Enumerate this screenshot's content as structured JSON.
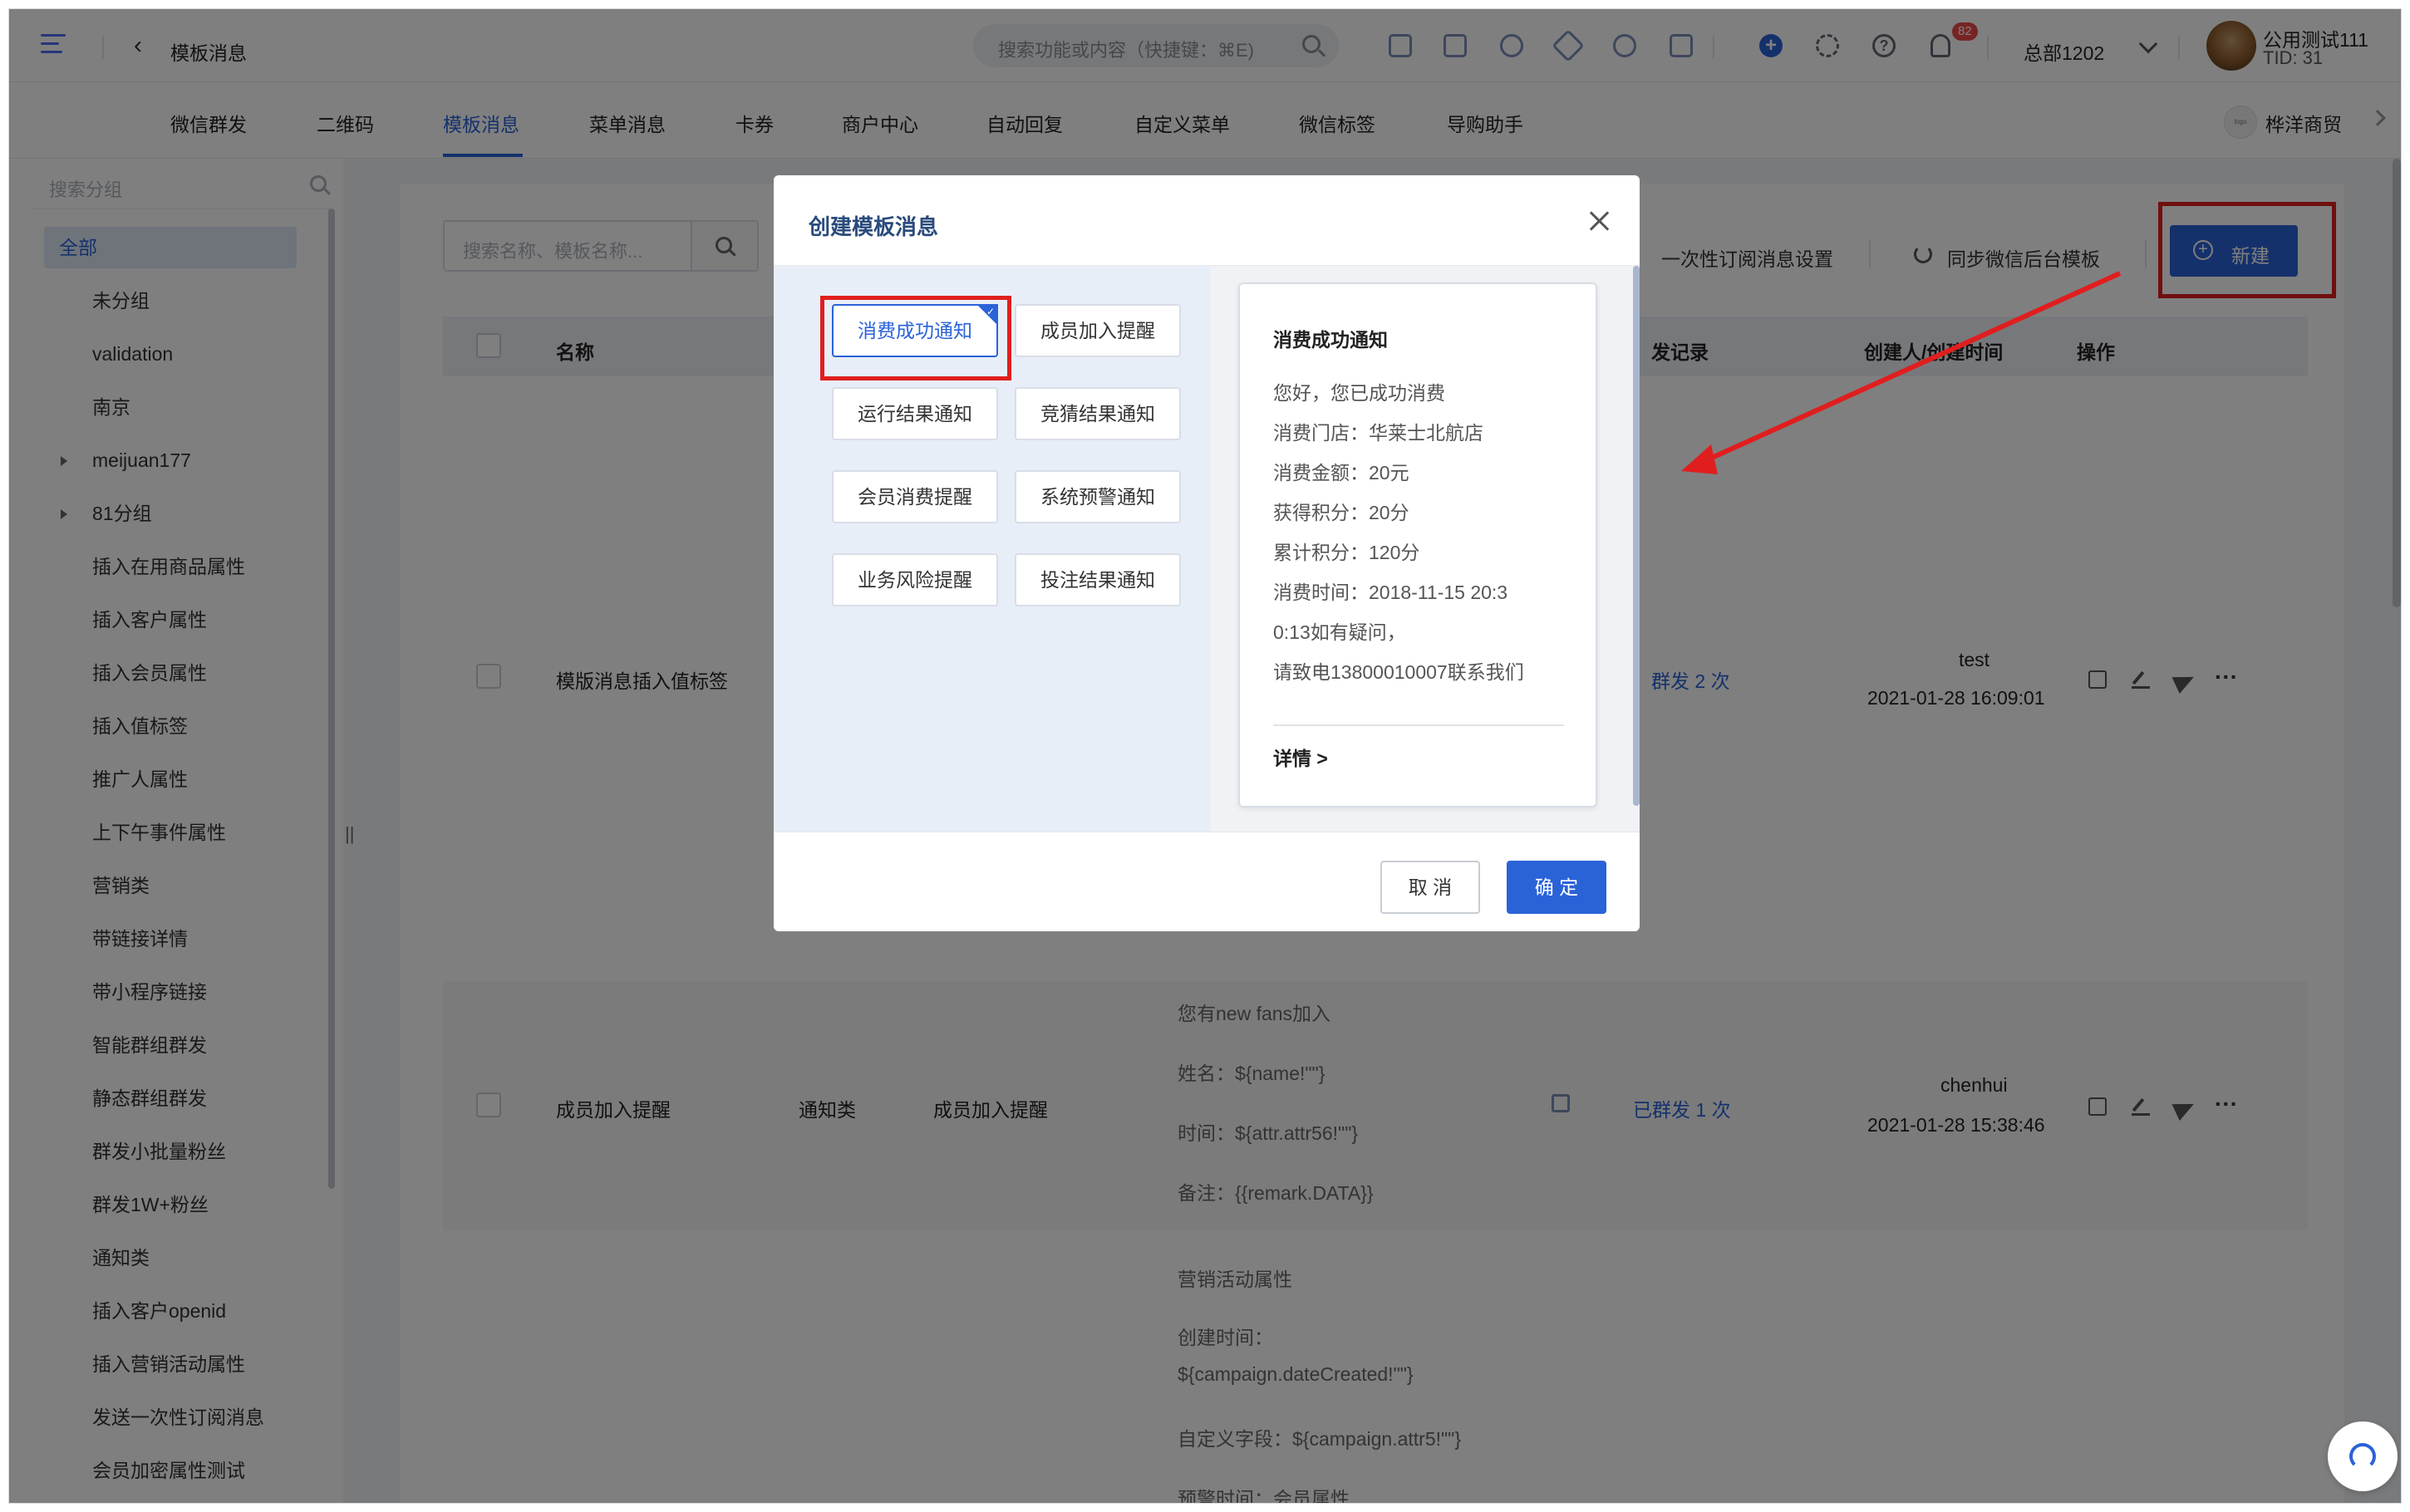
{
  "topbar": {
    "breadcrumb": "模板消息",
    "search_placeholder": "搜索功能或内容（快捷键：⌘E)",
    "notification_count": "82",
    "org_name": "总部1202",
    "user_name": "公用测试111",
    "user_tid": "TID: 31"
  },
  "nav": {
    "tabs": [
      {
        "label": "微信群发"
      },
      {
        "label": "二维码"
      },
      {
        "label": "模板消息"
      },
      {
        "label": "菜单消息"
      },
      {
        "label": "卡券"
      },
      {
        "label": "商户中心"
      },
      {
        "label": "自动回复"
      },
      {
        "label": "自定义菜单"
      },
      {
        "label": "微信标签"
      },
      {
        "label": "导购助手"
      }
    ],
    "active_tab": "模板消息",
    "shop_name": "桦洋商贸"
  },
  "sidebar": {
    "search_placeholder": "搜索分组",
    "items": [
      {
        "label": "全部"
      },
      {
        "label": "未分组"
      },
      {
        "label": "validation"
      },
      {
        "label": "南京"
      },
      {
        "label": "meijuan177"
      },
      {
        "label": "81分组"
      },
      {
        "label": "插入在用商品属性"
      },
      {
        "label": "插入客户属性"
      },
      {
        "label": "插入会员属性"
      },
      {
        "label": "插入值标签"
      },
      {
        "label": "推广人属性"
      },
      {
        "label": "上下午事件属性"
      },
      {
        "label": "营销类"
      },
      {
        "label": "带链接详情"
      },
      {
        "label": "带小程序链接"
      },
      {
        "label": "智能群组群发"
      },
      {
        "label": "静态群组群发"
      },
      {
        "label": "群发小批量粉丝"
      },
      {
        "label": "群发1W+粉丝"
      },
      {
        "label": "通知类"
      },
      {
        "label": "插入客户openid"
      },
      {
        "label": "插入营销活动属性"
      },
      {
        "label": "发送一次性订阅消息"
      },
      {
        "label": "会员加密属性测试"
      }
    ]
  },
  "main": {
    "search_placeholder": "搜索名称、模板名称...",
    "subscribe_settings": "一次性订阅消息设置",
    "sync_label": "同步微信后台模板",
    "new_button": "新建",
    "columns": {
      "name": "名称",
      "send_record": "发记录",
      "creator": "创建人/创建时间",
      "actions": "操作"
    },
    "rows": [
      {
        "name": "模版消息插入值标签",
        "send_status": "群发 2 次",
        "creator": "test",
        "created_time": "2021-01-28 16:09:01"
      },
      {
        "name": "成员加入提醒",
        "category": "通知类",
        "template": "成员加入提醒",
        "content": [
          "您有new fans加入",
          "姓名：${name!\"\"}",
          "时间：${attr.attr56!\"\"}",
          "备注：{{remark.DATA}}",
          "营销活动属性",
          "创建时间：",
          "${campaign.dateCreated!\"\"}",
          "自定义字段：${campaign.attr5!\"\"}",
          "预警时间：会员属性"
        ],
        "send_status": "已群发 1 次",
        "creator": "chenhui",
        "created_time": "2021-01-28 15:38:46"
      }
    ]
  },
  "modal": {
    "title": "创建模板消息",
    "templates": [
      {
        "label": "消费成功通知"
      },
      {
        "label": "成员加入提醒"
      },
      {
        "label": "运行结果通知"
      },
      {
        "label": "竞猜结果通知"
      },
      {
        "label": "会员消费提醒"
      },
      {
        "label": "系统预警通知"
      },
      {
        "label": "业务风险提醒"
      },
      {
        "label": "投注结果通知"
      }
    ],
    "selected_template": "消费成功通知",
    "preview": {
      "title": "消费成功通知",
      "lines": [
        "您好，您已成功消费",
        "消费门店：华莱士北航店",
        "消费金额：20元",
        "获得积分：20分",
        "累计积分：120分",
        "消费时间：2018-11-15  20:3",
        "0:13如有疑问，",
        "请致电13800010007联系我们"
      ],
      "detail": "详情 >"
    },
    "cancel": "取 消",
    "confirm": "确 定"
  },
  "colors": {
    "primary": "#2a62d8",
    "annotation_red": "#e01e1e",
    "overlay": "rgba(0,0,0,0.5)"
  }
}
